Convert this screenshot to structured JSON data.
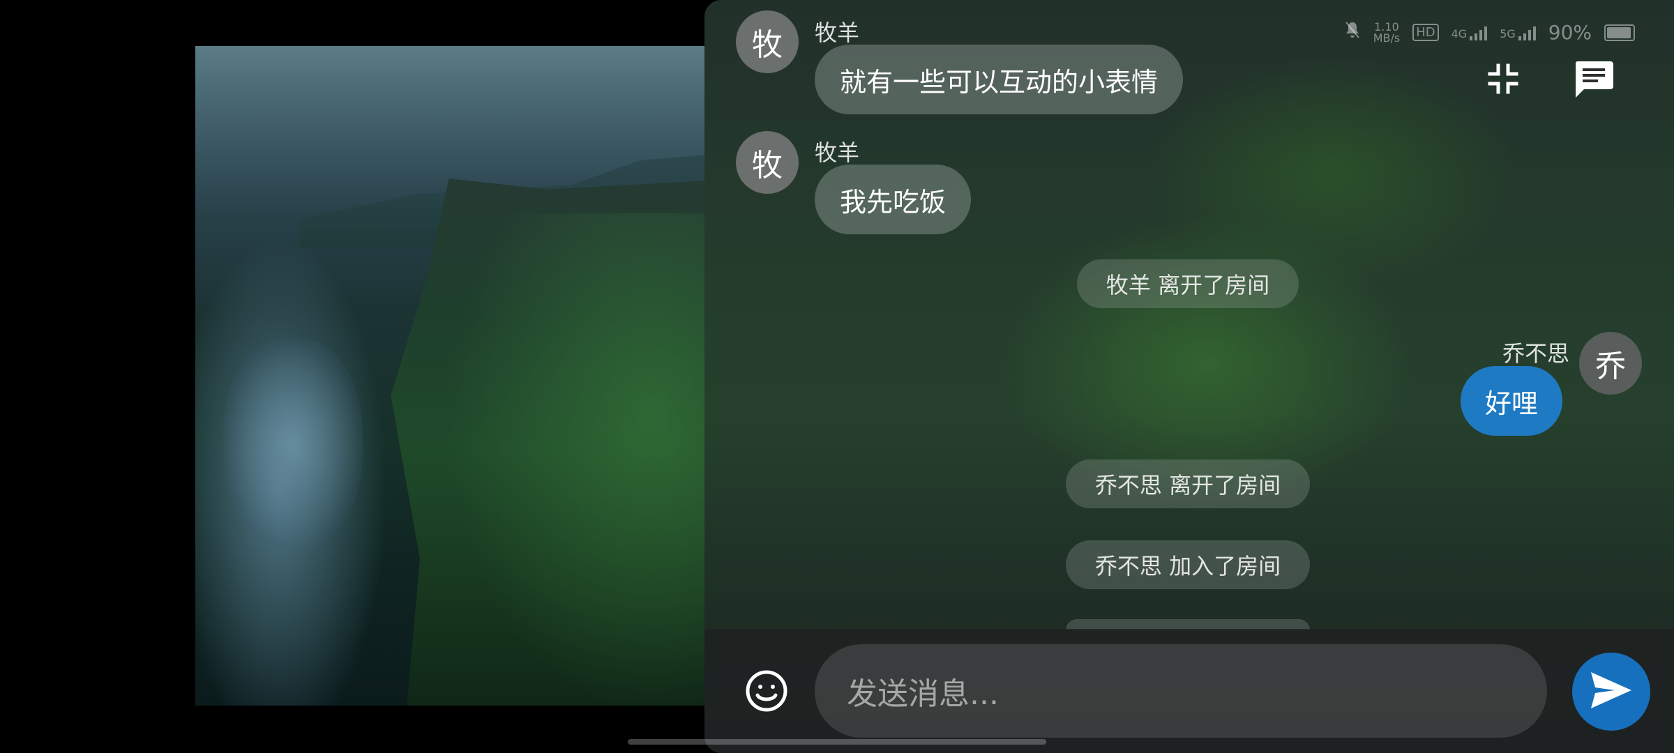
{
  "status_bar": {
    "speed_value": "1.10",
    "speed_unit": "MB/s",
    "hd_label": "HD",
    "net_4g": "4G",
    "net_5g": "5G",
    "battery": "90%"
  },
  "messages": [
    {
      "type": "other",
      "avatar": "牧",
      "sender": "牧羊",
      "text": "就有一些可以互动的小表情"
    },
    {
      "type": "other",
      "avatar": "牧",
      "sender": "牧羊",
      "text": "我先吃饭"
    },
    {
      "type": "system",
      "text": "牧羊 离开了房间"
    },
    {
      "type": "me",
      "avatar": "乔",
      "sender": "乔不思",
      "text": "好哩"
    },
    {
      "type": "system",
      "text": "乔不思 离开了房间"
    },
    {
      "type": "system",
      "text": "乔不思 加入了房间"
    }
  ],
  "input": {
    "placeholder": "发送消息..."
  },
  "icons": {
    "minimize": "compress-icon",
    "chat": "chat-icon",
    "emoji": "emoji-icon",
    "send": "send-icon"
  },
  "colors": {
    "my_bubble": "#1e7ac2",
    "send_button": "#1670bd"
  }
}
